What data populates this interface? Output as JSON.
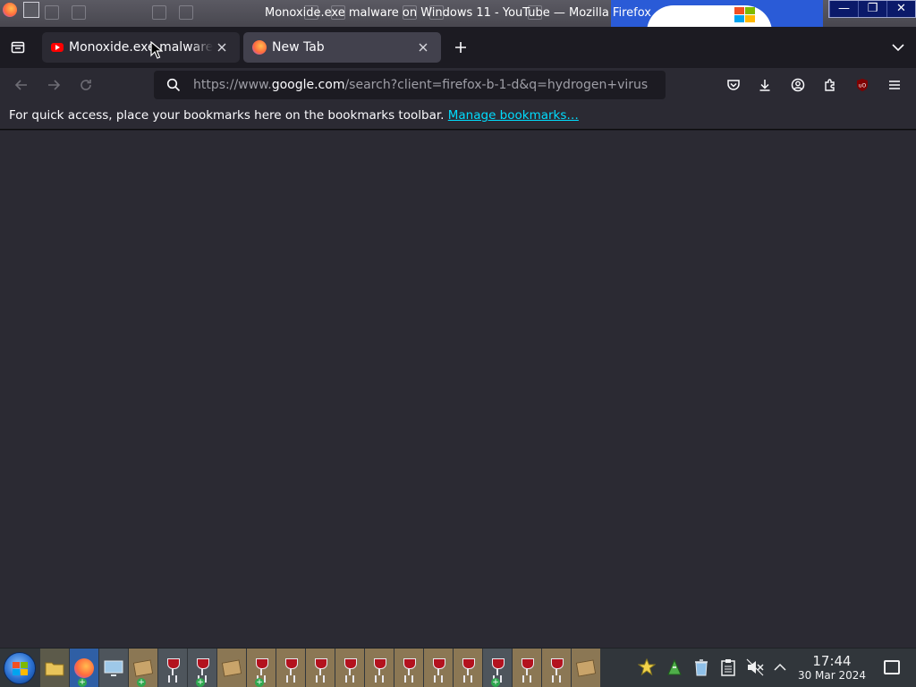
{
  "window": {
    "title": "Monoxide.exe malware on Windows 11 - YouTube — Mozilla Firefox",
    "controls": [
      "minimize",
      "maximize",
      "close"
    ]
  },
  "tabs": [
    {
      "label": "Monoxide.exe malware on Windows 11 - YouTube",
      "icon": "youtube-icon",
      "active": true
    },
    {
      "label": "New Tab",
      "icon": "firefox-icon",
      "active": false
    }
  ],
  "toolbar": {
    "url_scheme": "https://www.",
    "url_domain": "google.com",
    "url_path": "/search?client=firefox-b-1-d&q=hydrogen+virus",
    "icons": [
      "pocket-icon",
      "download-icon",
      "account-icon",
      "extensions-icon",
      "ublock-icon",
      "menu-icon"
    ]
  },
  "bookmarks_bar": {
    "message": "For quick access, place your bookmarks here on the bookmarks toolbar.",
    "link": "Manage bookmarks…"
  },
  "taskbar": {
    "time": "17:44",
    "date": "30 Mar 2024",
    "volume": "muted"
  },
  "colors": {
    "chrome_bg": "#1c1b22",
    "toolbar_bg": "#2b2a33",
    "active_tab": "#42414d",
    "link": "#00ddff",
    "taskbar_bg": "#31363b"
  }
}
